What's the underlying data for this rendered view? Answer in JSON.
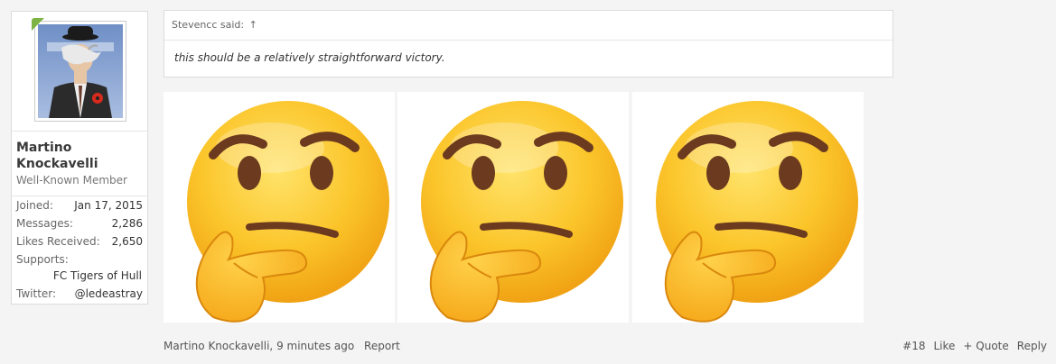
{
  "user": {
    "name": "Martino Knockavelli",
    "title": "Well-Known Member",
    "stats": [
      {
        "label": "Joined:",
        "value": "Jan 17, 2015"
      },
      {
        "label": "Messages:",
        "value": "2,286"
      },
      {
        "label": "Likes Received:",
        "value": "2,650"
      }
    ],
    "supports_label": "Supports:",
    "supports_value": "FC Tigers of Hull",
    "twitter_label": "Twitter:",
    "twitter_value": "@ledeastray"
  },
  "quote": {
    "attribution": "Stevencc said:",
    "arrow": "↑",
    "text": "this should be a relatively straightforward victory."
  },
  "images": [
    {
      "icon": "thinking-face-emoji"
    },
    {
      "icon": "thinking-face-emoji"
    },
    {
      "icon": "thinking-face-emoji"
    }
  ],
  "footer": {
    "author_time": "Martino Knockavelli, 9 minutes ago",
    "report": "Report",
    "post_number": "#18",
    "like": "Like",
    "quote": "+ Quote",
    "reply": "Reply"
  },
  "colors": {
    "page_bg": "#f4f4f4",
    "corner_badge": "#7cb342",
    "emoji_yellow": "#f7c21b"
  }
}
